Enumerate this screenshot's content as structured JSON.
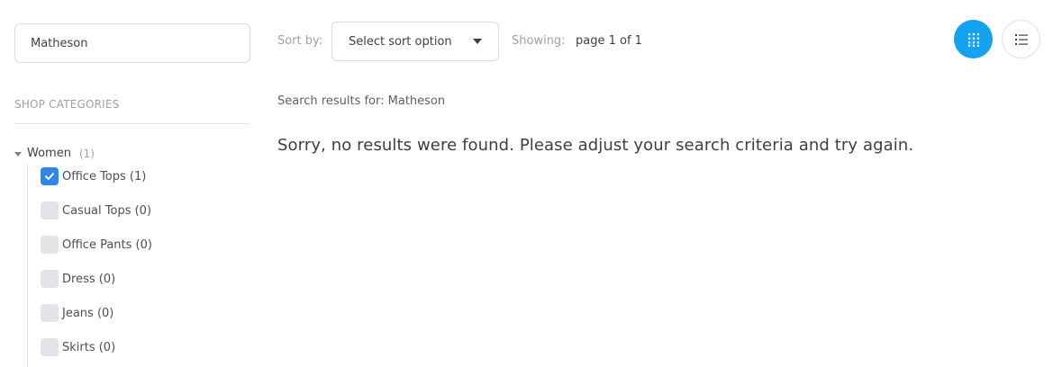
{
  "search": {
    "value": "Matheson"
  },
  "sidebar": {
    "heading": "SHOP CATEGORIES",
    "parent": {
      "label": "Women",
      "count": "(1)"
    },
    "items": [
      {
        "label": "Office Tops (1)",
        "checked": true
      },
      {
        "label": "Casual Tops (0)",
        "checked": false
      },
      {
        "label": "Office Pants (0)",
        "checked": false
      },
      {
        "label": "Dress (0)",
        "checked": false
      },
      {
        "label": "Jeans (0)",
        "checked": false
      },
      {
        "label": "Skirts (0)",
        "checked": false
      }
    ]
  },
  "toolbar": {
    "sort_label": "Sort by:",
    "sort_value": "Select sort option",
    "showing_label": "Showing:",
    "showing_value": "page 1 of 1",
    "grid_icon": "grid-view-icon",
    "list_icon": "list-view-icon"
  },
  "results": {
    "search_label": "Search results for: Matheson",
    "message": "Sorry, no results were found. Please adjust your search criteria and try again."
  },
  "colors": {
    "accent": "#13a3f0",
    "checkbox_checked": "#2f86ea",
    "checkbox_empty": "#e2e4e7"
  }
}
